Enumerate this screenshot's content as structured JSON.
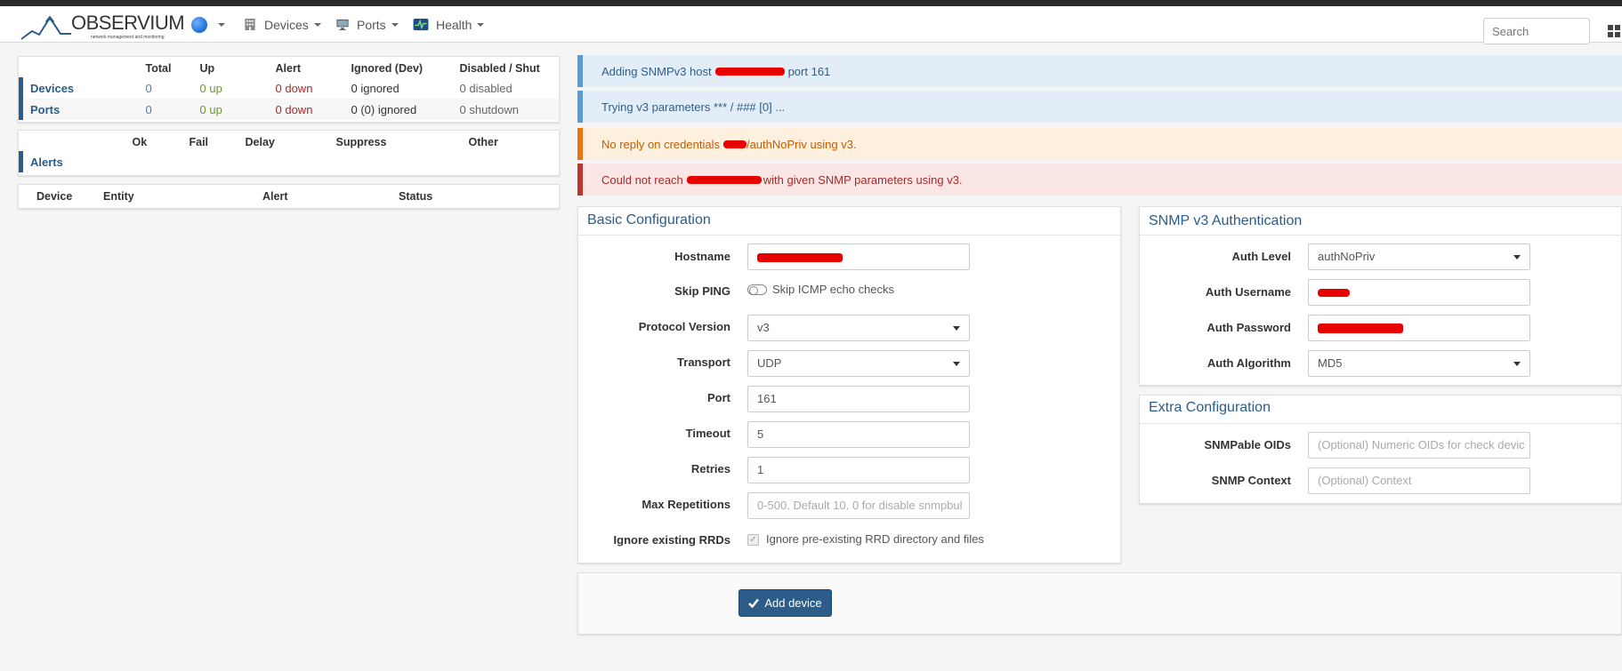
{
  "nav": {
    "brand": "OBSERVIUM",
    "brand_tagline": "network management and monitoring",
    "devices": "Devices",
    "ports": "Ports",
    "health": "Health",
    "search_placeholder": "Search"
  },
  "status_table": {
    "headers": [
      "Total",
      "Up",
      "Alert",
      "Ignored (Dev)",
      "Disabled / Shut"
    ],
    "rows": [
      {
        "label": "Devices",
        "total": "0",
        "up": "0 up",
        "alert": "0 down",
        "ignored": "0 ignored",
        "disabled": "0 disabled"
      },
      {
        "label": "Ports",
        "total": "0",
        "up": "0 up",
        "alert": "0 down",
        "ignored": "0 (0) ignored",
        "disabled": "0 shutdown"
      }
    ]
  },
  "alerts_table": {
    "headers": [
      "Ok",
      "Fail",
      "Delay",
      "Suppress",
      "Other"
    ],
    "label": "Alerts"
  },
  "alert_list": {
    "headers": [
      "Device",
      "Entity",
      "Alert",
      "Status"
    ]
  },
  "messages": {
    "m1_pre": "Adding SNMPv3 host",
    "m1_post": "port 161",
    "m2": "Trying v3 parameters *** / ### [0] ...",
    "m3_pre": "No reply on credentials",
    "m3_post": "/authNoPriv using v3.",
    "m4_pre": "Could not reach",
    "m4_post": "with given SNMP parameters using v3."
  },
  "basic": {
    "title": "Basic Configuration",
    "hostname_label": "Hostname",
    "skip_ping_label": "Skip PING",
    "skip_ping_hint": "Skip ICMP echo checks",
    "protocol_label": "Protocol Version",
    "protocol_value": "v3",
    "transport_label": "Transport",
    "transport_value": "UDP",
    "port_label": "Port",
    "port_value": "161",
    "timeout_label": "Timeout",
    "timeout_value": "5",
    "retries_label": "Retries",
    "retries_value": "1",
    "maxrep_label": "Max Repetitions",
    "maxrep_placeholder": "0-500. Default 10. 0 for disable snmpbul",
    "ignore_label": "Ignore existing RRDs",
    "ignore_hint": "Ignore pre-existing RRD directory and files"
  },
  "snmp": {
    "title": "SNMP v3 Authentication",
    "auth_level_label": "Auth Level",
    "auth_level_value": "authNoPriv",
    "auth_user_label": "Auth Username",
    "auth_pass_label": "Auth Password",
    "auth_algo_label": "Auth Algorithm",
    "auth_algo_value": "MD5"
  },
  "extra": {
    "title": "Extra Configuration",
    "oids_label": "SNMPable OIDs",
    "oids_placeholder": "(Optional) Numeric OIDs for check devic",
    "context_label": "SNMP Context",
    "context_placeholder": "(Optional) Context"
  },
  "add_button": "Add device"
}
